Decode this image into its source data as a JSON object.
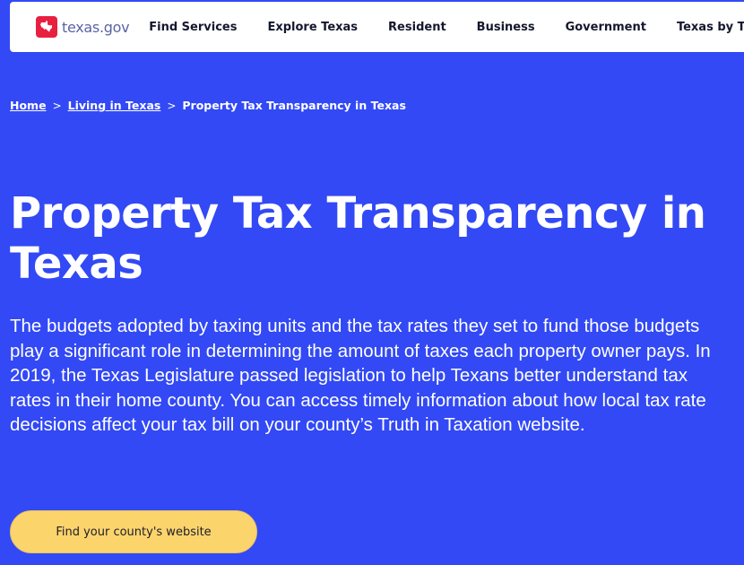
{
  "header": {
    "logo_text": "texas.gov",
    "nav": [
      {
        "label": "Find Services"
      },
      {
        "label": "Explore Texas"
      },
      {
        "label": "Resident"
      },
      {
        "label": "Business"
      },
      {
        "label": "Government"
      },
      {
        "label": "Texas by Texas"
      }
    ]
  },
  "breadcrumb": {
    "items": [
      {
        "label": "Home"
      },
      {
        "label": "Living in Texas"
      }
    ],
    "current": "Property Tax Transparency in Texas",
    "separator": ">"
  },
  "main": {
    "title": "Property Tax Transparency in Texas",
    "intro": "The budgets adopted by taxing units and the tax rates they set to fund those budgets play a significant role in determining the amount of taxes each property owner pays. In 2019, the Texas Legislature passed legislation to help Texans better understand tax rates in their home county. You can access timely information about how local tax rate decisions affect your tax bill on your county’s Truth in Taxation website.",
    "cta_label": "Find your county's website"
  },
  "colors": {
    "background": "#3249f5",
    "logo_red": "#e8203f",
    "cta": "#fcd46c"
  }
}
